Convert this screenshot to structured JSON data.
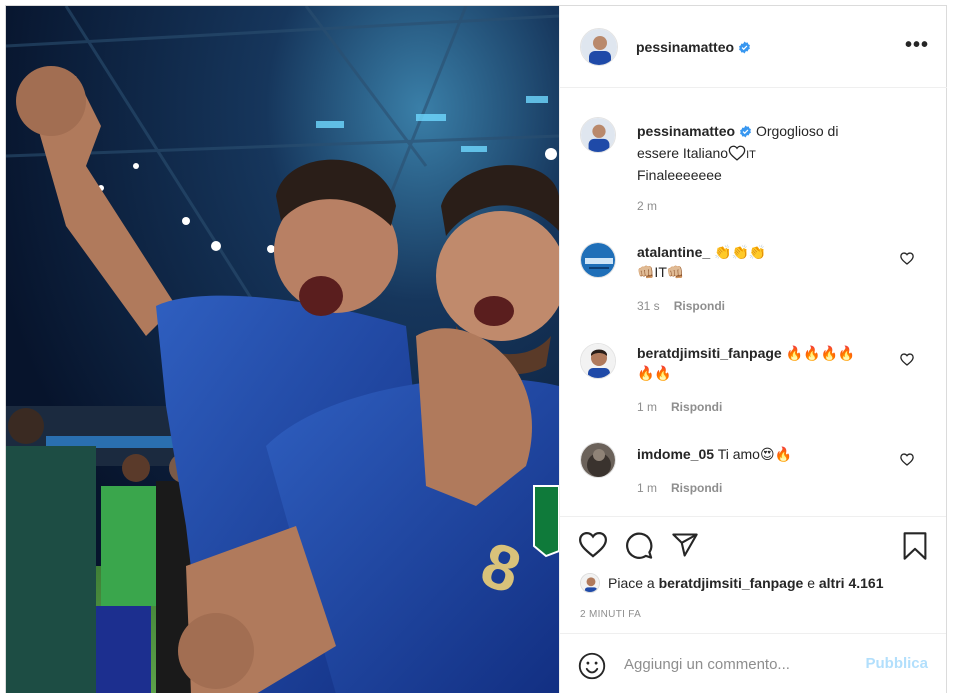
{
  "post": {
    "author": "pessinamatteo",
    "verified": true,
    "caption_line1": "Orgoglioso di",
    "caption_line2": "essere Italiano",
    "caption_flag": "IT",
    "caption_line3": "Finaleeeeeee",
    "caption_time": "2 m"
  },
  "comments": [
    {
      "user": "atalantine_",
      "text": "👏👏👏",
      "text2": "👊🏼IT👊🏼",
      "time": "31 s",
      "reply": "Rispondi"
    },
    {
      "user": "beratdjimsiti_fanpage",
      "text": "🔥🔥🔥🔥",
      "text2": "🔥🔥",
      "time": "1 m",
      "reply": "Rispondi"
    },
    {
      "user": "imdome_05",
      "text": "Ti amo😍🔥",
      "text2": "",
      "time": "1 m",
      "reply": "Rispondi"
    }
  ],
  "likes": {
    "prefix": "Piace a",
    "user": "beratdjimsiti_fanpage",
    "joiner": "e",
    "others": "altri 4.161"
  },
  "timestamp": "2 MINUTI FA",
  "add_comment": {
    "placeholder": "Aggiungi un commento...",
    "publish": "Pubblica"
  },
  "icons": {
    "more": "more-options-icon",
    "like": "heart-icon",
    "comment": "comment-icon",
    "share": "share-icon",
    "save": "bookmark-icon",
    "emoji": "emoji-icon"
  },
  "colors": {
    "verified": "#3897f0",
    "publish_disabled": "#b2dffc",
    "muted": "#8e8e8e"
  }
}
